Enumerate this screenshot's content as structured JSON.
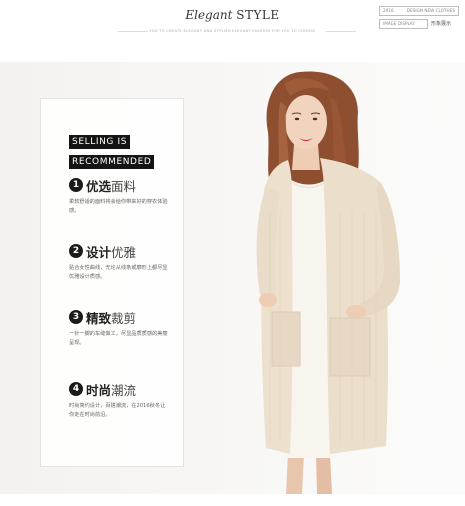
{
  "header": {
    "title_a": "Elegant ",
    "title_b": "STYLE",
    "subtitle": "YOU TO CREATE ELEGANT AND STYLISH ELEGANT FASHION FOR YOU TO CHOOSE",
    "tag1_a": "2016",
    "tag1_b": "DESIGN NEW CLOTHES",
    "tag2": "IMAGE DISPLAY",
    "tag2_cn": "形象展示"
  },
  "panel": {
    "badge_line1": "SELLING IS",
    "badge_line2": "RECOMMENDED",
    "items": [
      {
        "num": "1",
        "kw_bold": "优选",
        "kw_light": "面料",
        "desc": "柔软舒适的面料将会给你带来好的穿衣体验感。"
      },
      {
        "num": "2",
        "kw_bold": "设计",
        "kw_light": "优雅",
        "desc": "贴合女性曲线，无论从线条或廓形上都尽显优雅设计质感。"
      },
      {
        "num": "3",
        "kw_bold": "精致",
        "kw_light": "裁剪",
        "desc": "一针一脚的车缝做工，尽显品质质感的美丽呈现。"
      },
      {
        "num": "4",
        "kw_bold": "时尚",
        "kw_light": "潮流",
        "desc": "时尚简约设计，百搭潮流，在2016秋冬让你走在时尚前沿。"
      }
    ]
  },
  "colors": {
    "background": "#f5f4f1",
    "cardigan": "#ede1ce",
    "dress": "#f8f4ee",
    "hair": "#9c5a38",
    "badge": "#141414"
  }
}
